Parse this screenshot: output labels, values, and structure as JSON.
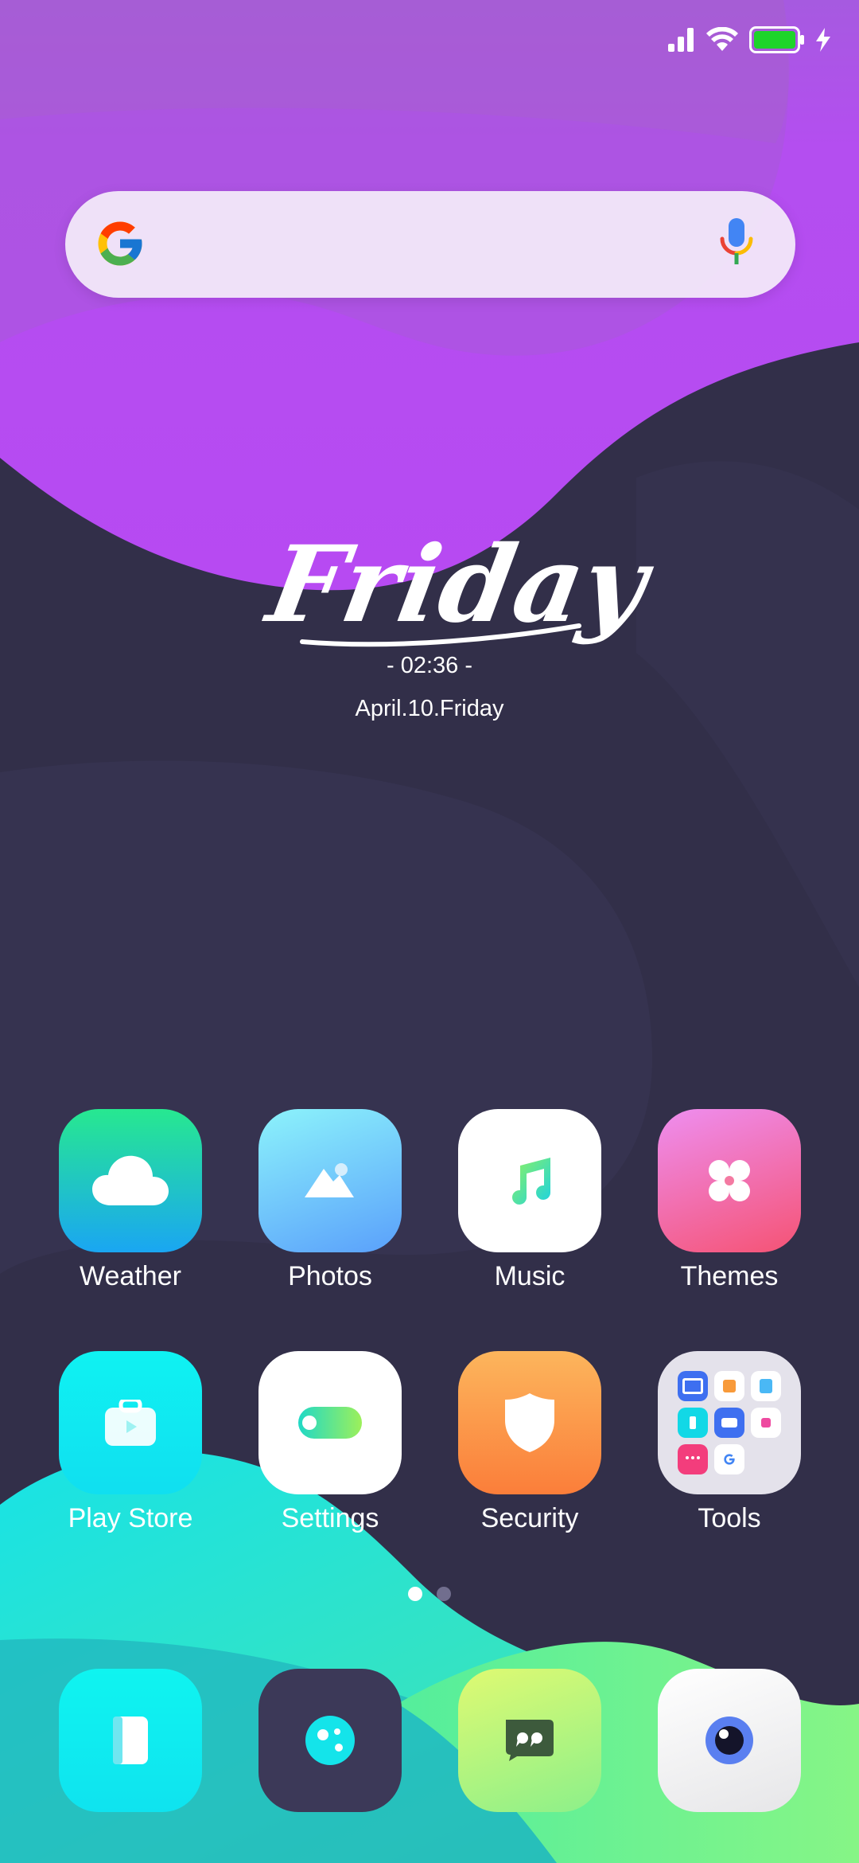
{
  "status_bar": {
    "icons": [
      "signal-icon",
      "wifi-icon",
      "battery-icon",
      "charging-icon"
    ],
    "battery_color": "#1ed42a"
  },
  "search_widget": {
    "logo": "google-g-icon",
    "voice": "microphone-icon"
  },
  "clock_widget": {
    "day": "Friday",
    "time": "- 02:36 -",
    "date": "April.10.Friday"
  },
  "apps": [
    {
      "label": "Weather",
      "icon": "cloud-icon"
    },
    {
      "label": "Photos",
      "icon": "mountain-photo-icon"
    },
    {
      "label": "Music",
      "icon": "music-note-icon"
    },
    {
      "label": "Themes",
      "icon": "themes-icon"
    },
    {
      "label": "Play Store",
      "icon": "shopping-bag-play-icon"
    },
    {
      "label": "Settings",
      "icon": "toggle-icon"
    },
    {
      "label": "Security",
      "icon": "shield-icon"
    },
    {
      "label": "Tools",
      "icon": "folder-icon"
    }
  ],
  "page_indicator": {
    "pages": 2,
    "current": 1
  },
  "dock": [
    {
      "icon": "phone-book-icon"
    },
    {
      "icon": "chat-bubble-dots-icon"
    },
    {
      "icon": "message-quote-icon"
    },
    {
      "icon": "camera-eye-icon"
    }
  ],
  "colors": {
    "background": "#322f49",
    "wallpaper_purple": "#b84ff0",
    "wallpaper_cyan": "#1ee6d8",
    "wallpaper_green": "#6ef28a"
  }
}
